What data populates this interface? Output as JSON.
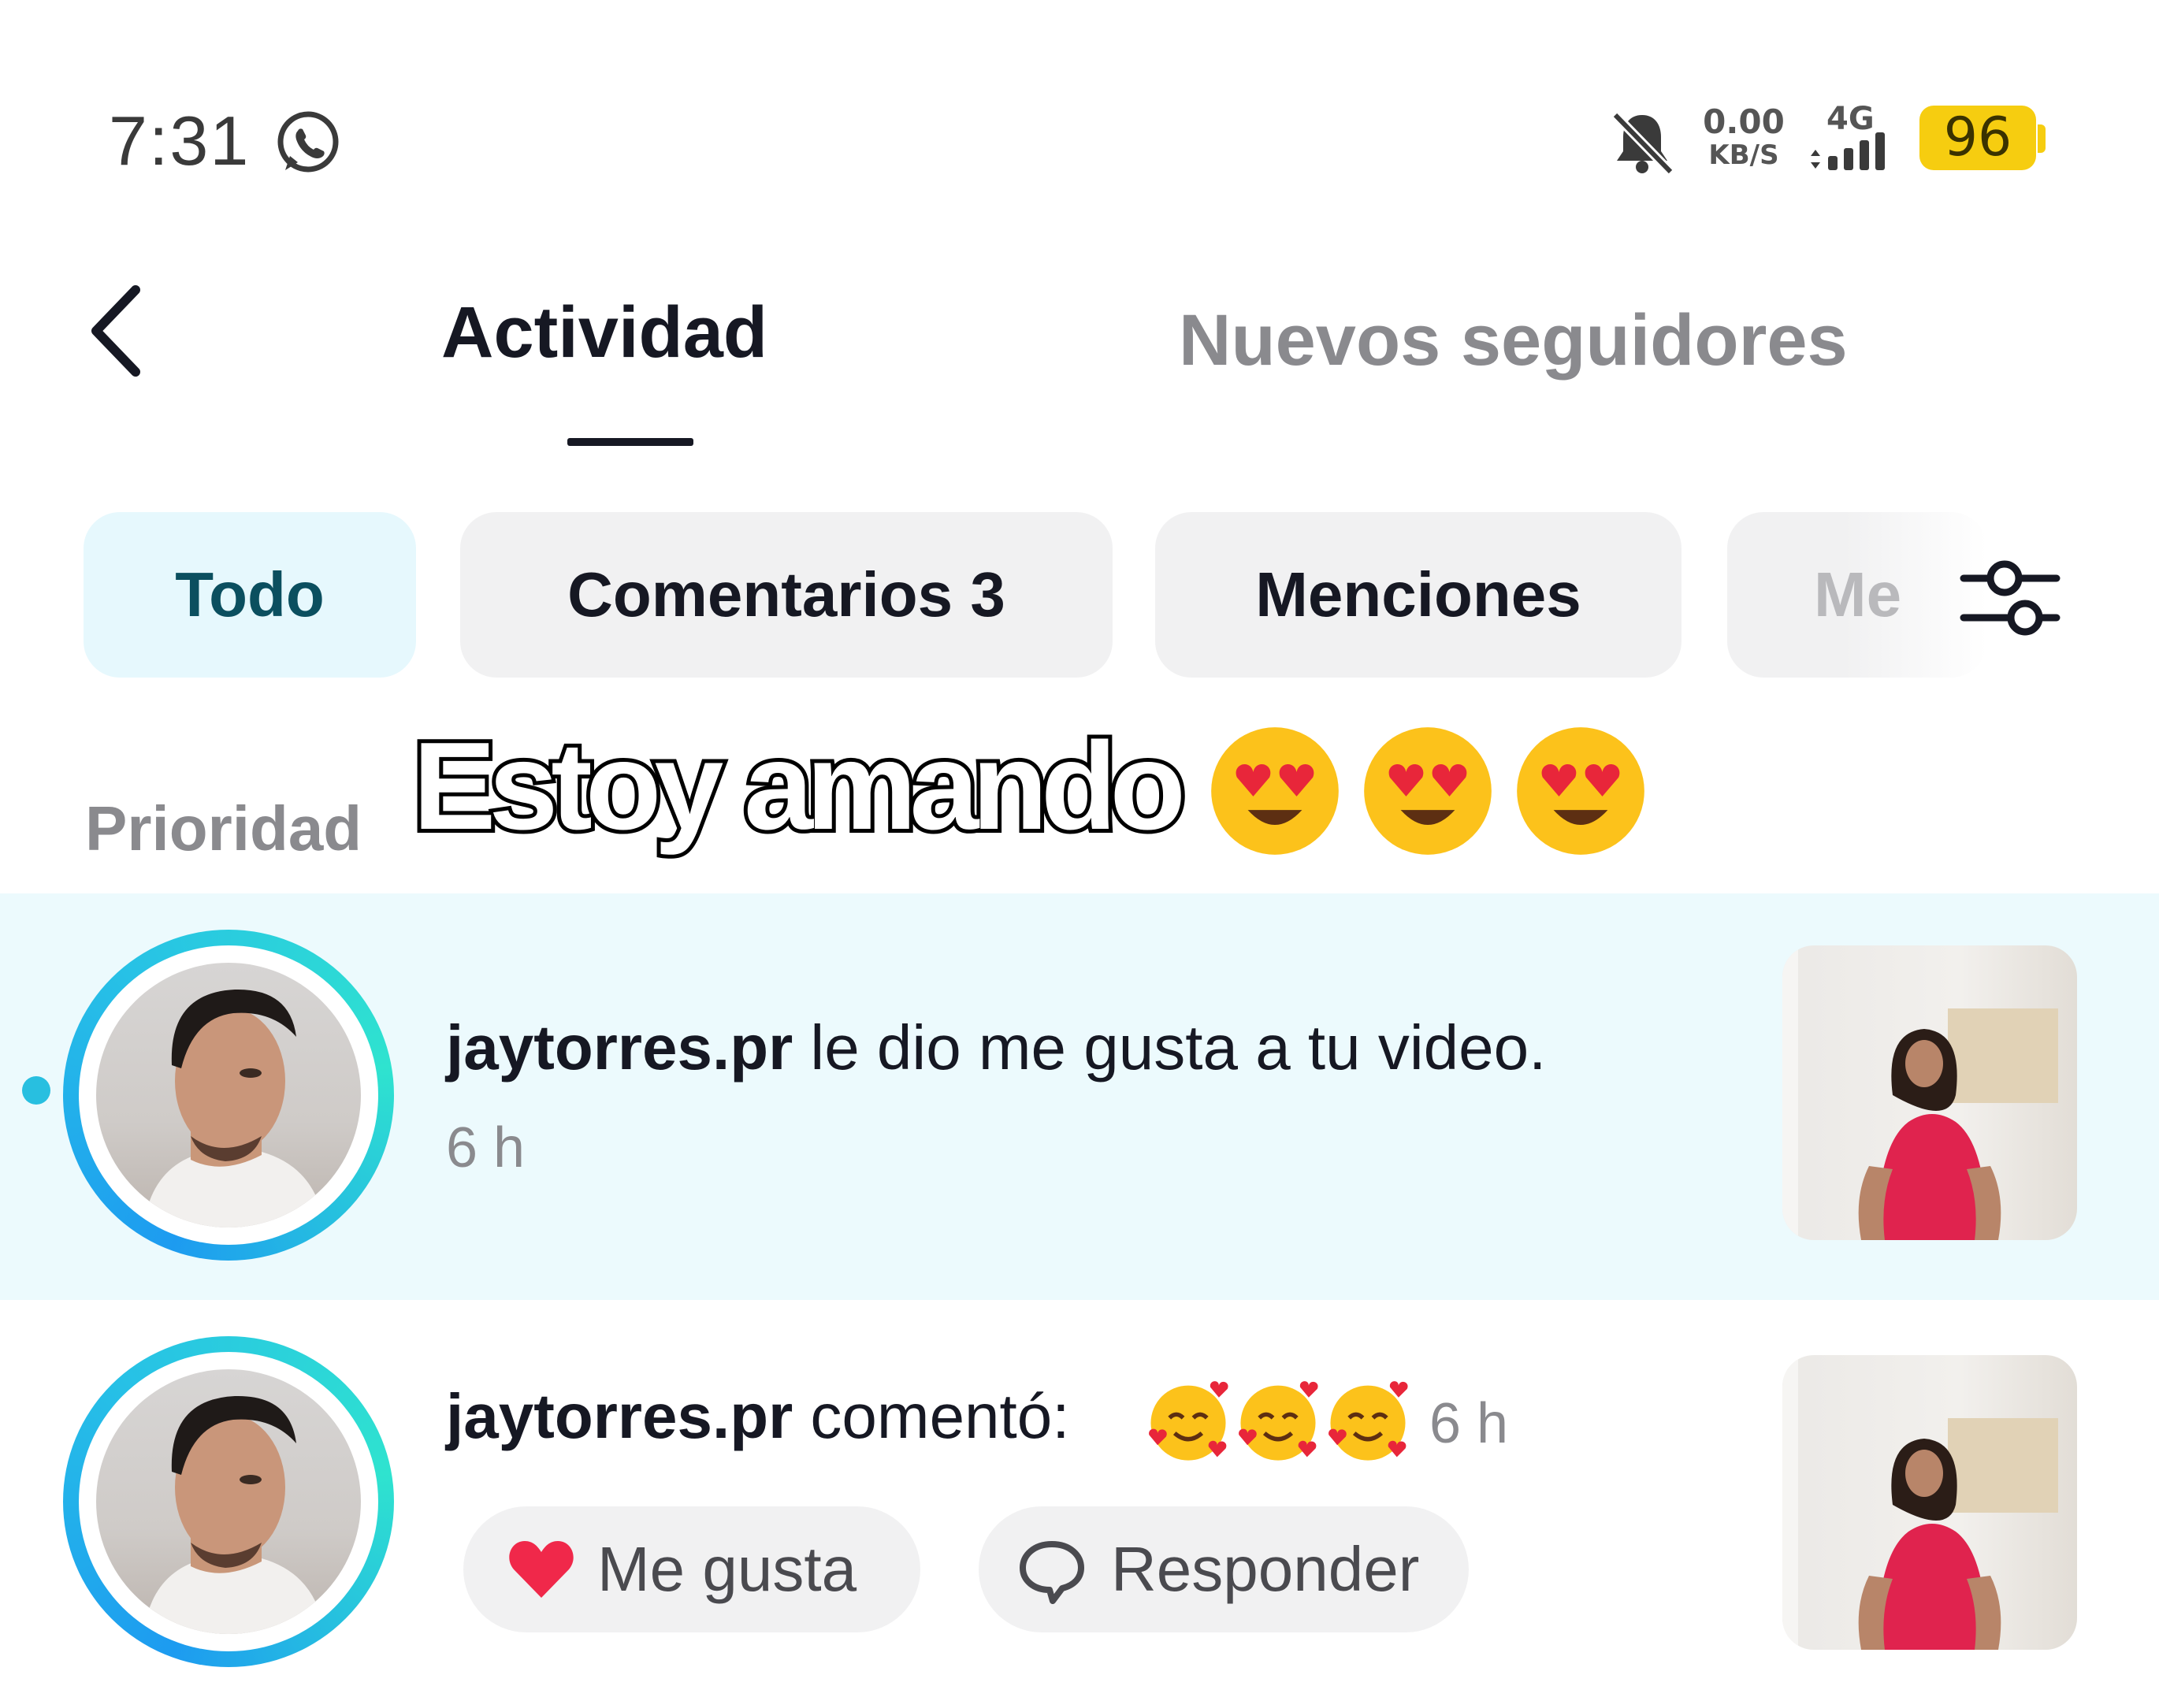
{
  "status_bar": {
    "time": "7:31",
    "net_speed_value": "0.00",
    "net_speed_unit": "KB/S",
    "network_type": "4G",
    "battery": "96",
    "battery_color": "#f6cd10"
  },
  "header": {
    "tabs": [
      {
        "label": "Actividad",
        "active": true
      },
      {
        "label": "Nuevos seguidores",
        "active": false
      }
    ]
  },
  "filters": {
    "chips": [
      "Todo",
      "Comentarios 3",
      "Menciones",
      "Me"
    ],
    "selected": "Todo",
    "selected_color": "#e6f8fd"
  },
  "section": {
    "title": "Prioridad"
  },
  "overlay_caption": "Estoy amando",
  "activities": [
    {
      "username": "jaytorres.pr",
      "action": " le dio me gusta a tu video.",
      "time": "6 h",
      "unread": true
    },
    {
      "username": "jaytorres.pr",
      "action": " comentó: ",
      "time": "6 h",
      "buttons": {
        "like": "Me gusta",
        "reply": "Responder"
      }
    }
  ],
  "icons": [
    "whatsapp-icon",
    "bell-muted-icon",
    "signal-icon",
    "back-icon",
    "filter-sliders-icon",
    "heart-icon",
    "comment-bubble-icon",
    "heart-eyes-emoji",
    "smiling-hearts-emoji"
  ],
  "accent_color": "#28bfe0"
}
